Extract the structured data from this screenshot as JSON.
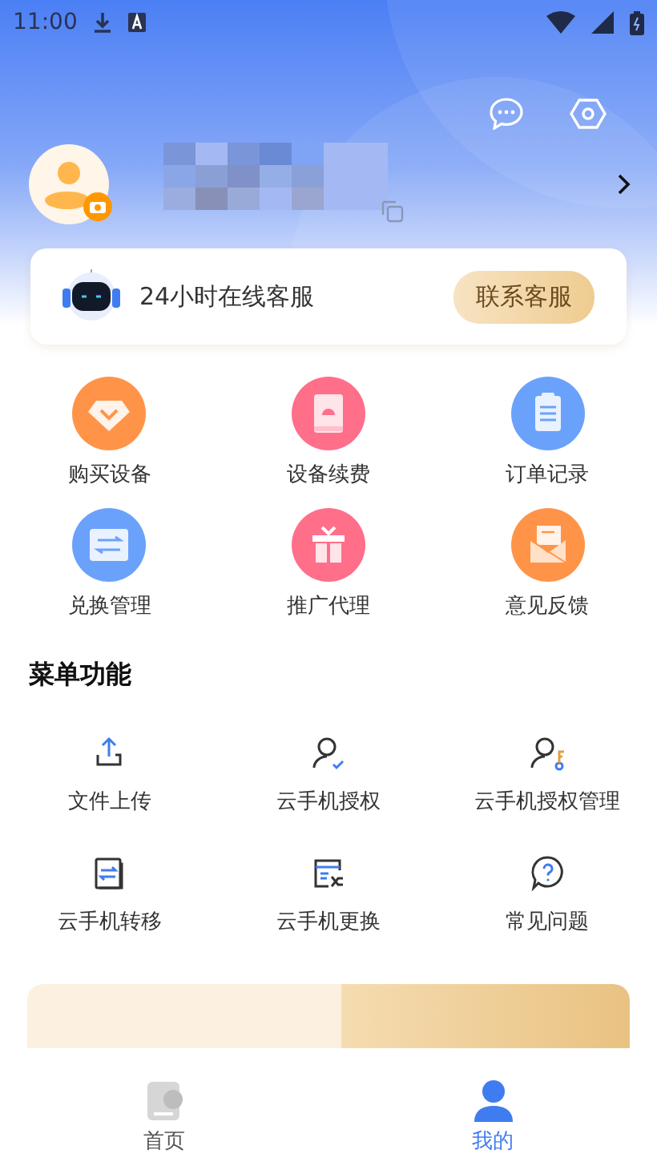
{
  "status_bar": {
    "time": "11:00"
  },
  "support": {
    "text": "24小时在线客服",
    "button": "联系客服"
  },
  "services": [
    {
      "label": "购买设备",
      "kind": "diamond",
      "color": "#ff9448"
    },
    {
      "label": "设备续费",
      "kind": "book",
      "color": "#ff6f8a"
    },
    {
      "label": "订单记录",
      "kind": "clipboard",
      "color": "#6aa2fb"
    },
    {
      "label": "兑换管理",
      "kind": "exchange",
      "color": "#6aa2fb"
    },
    {
      "label": "推广代理",
      "kind": "gift",
      "color": "#ff6f8a"
    },
    {
      "label": "意见反馈",
      "kind": "mail",
      "color": "#ff9448"
    }
  ],
  "menu": {
    "title": "菜单功能",
    "items": [
      {
        "label": "文件上传",
        "kind": "upload"
      },
      {
        "label": "云手机授权",
        "kind": "user-check"
      },
      {
        "label": "云手机授权管理",
        "kind": "user-key"
      },
      {
        "label": "云手机转移",
        "kind": "transfer"
      },
      {
        "label": "云手机更换",
        "kind": "swap"
      },
      {
        "label": "常见问题",
        "kind": "question"
      }
    ]
  },
  "tabs": [
    {
      "label": "首页",
      "selected": false
    },
    {
      "label": "我的",
      "selected": true
    }
  ]
}
